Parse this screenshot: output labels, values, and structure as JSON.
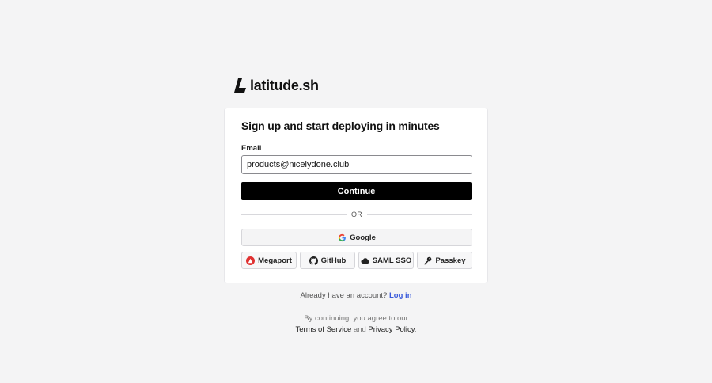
{
  "brand": {
    "name": "latitude.sh",
    "logo_icon": "latitude-logo-icon"
  },
  "signup": {
    "title": "Sign up and start deploying in minutes",
    "email_label": "Email",
    "email_value": "products@nicelydone.club",
    "continue_label": "Continue",
    "divider_text": "OR",
    "google": {
      "label": "Google",
      "icon": "google-icon"
    },
    "providers": [
      {
        "label": "Megaport",
        "icon": "megaport-icon"
      },
      {
        "label": "GitHub",
        "icon": "github-icon"
      },
      {
        "label": "SAML SSO",
        "icon": "cloud-icon"
      },
      {
        "label": "Passkey",
        "icon": "key-icon"
      }
    ]
  },
  "login": {
    "prompt": "Already have an account?",
    "link": "Log in"
  },
  "terms": {
    "line1": "By continuing, you agree to our",
    "tos": "Terms of Service",
    "and": "and",
    "privacy": "Privacy Policy",
    "period": "."
  },
  "colors": {
    "background": "#f4f4f5",
    "primary_button": "#000000",
    "link": "#3b5bdb",
    "megaport_red": "#e03131"
  }
}
